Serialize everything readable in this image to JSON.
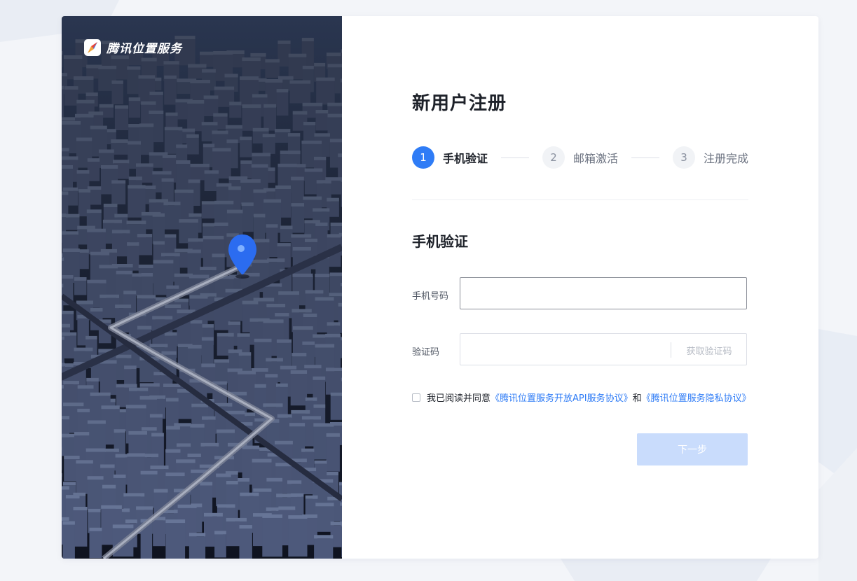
{
  "brand": {
    "name": "腾讯位置服务",
    "logo_icon": "compass-icon"
  },
  "page": {
    "title": "新用户注册"
  },
  "steps": [
    {
      "number": "1",
      "label": "手机验证",
      "state": "active"
    },
    {
      "number": "2",
      "label": "邮箱激活",
      "state": "inactive"
    },
    {
      "number": "3",
      "label": "注册完成",
      "state": "inactive"
    }
  ],
  "section": {
    "title": "手机验证"
  },
  "phone": {
    "label": "手机号码",
    "value": "",
    "placeholder": ""
  },
  "code": {
    "label": "验证码",
    "value": "",
    "placeholder": "",
    "button": "获取验证码"
  },
  "agreement": {
    "checked": false,
    "prefix": "我已阅读并同意",
    "link1": "《腾讯位置服务开放API服务协议》",
    "connector": "和",
    "link2": "《腾讯位置服务隐私协议》"
  },
  "submit": {
    "label": "下一步",
    "enabled": false
  },
  "colors": {
    "accent": "#2f7cf6",
    "disabled_button": "#c9dcfc",
    "pin": "#2b6cf0"
  }
}
